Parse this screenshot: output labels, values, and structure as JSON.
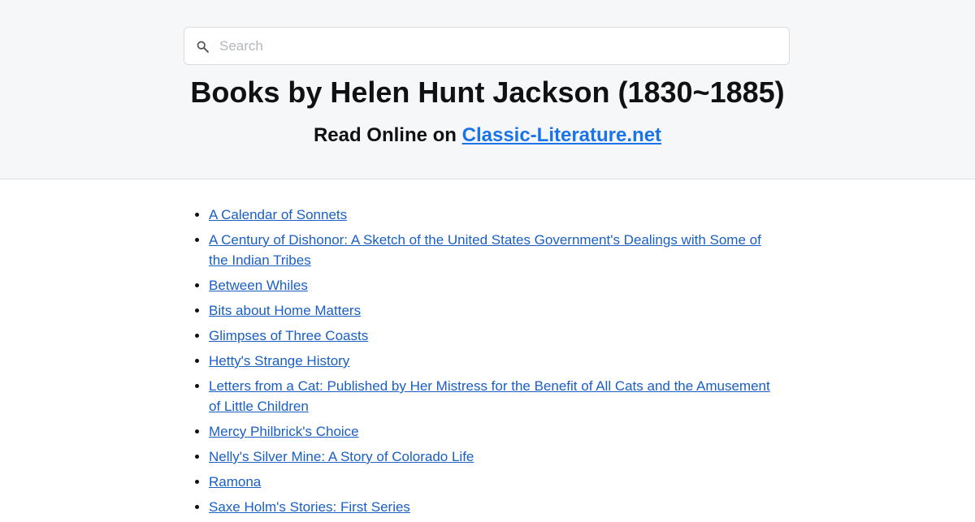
{
  "search": {
    "placeholder": "Search",
    "value": "",
    "icon": "search-icon"
  },
  "header": {
    "title": "Books by Helen Hunt Jackson (1830~1885)",
    "subtitle_prefix": "Read Online on ",
    "site_link": "Classic-Literature.net",
    "link_color": "#1a73e8"
  },
  "books": [
    "A Calendar of Sonnets",
    "A Century of Dishonor: A Sketch of the United States Government's Dealings with Some of the Indian Tribes",
    "Between Whiles",
    "Bits about Home Matters",
    "Glimpses of Three Coasts",
    "Hetty's Strange History",
    "Letters from a Cat: Published by Her Mistress for the Benefit of All Cats and the Amusement of Little Children",
    "Mercy Philbrick's Choice",
    "Nelly's Silver Mine: A Story of Colorado Life",
    "Ramona",
    "Saxe Holm's Stories: First Series"
  ],
  "colors": {
    "header_bg": "#f6f7f9",
    "book_link": "#1a5fc4"
  }
}
